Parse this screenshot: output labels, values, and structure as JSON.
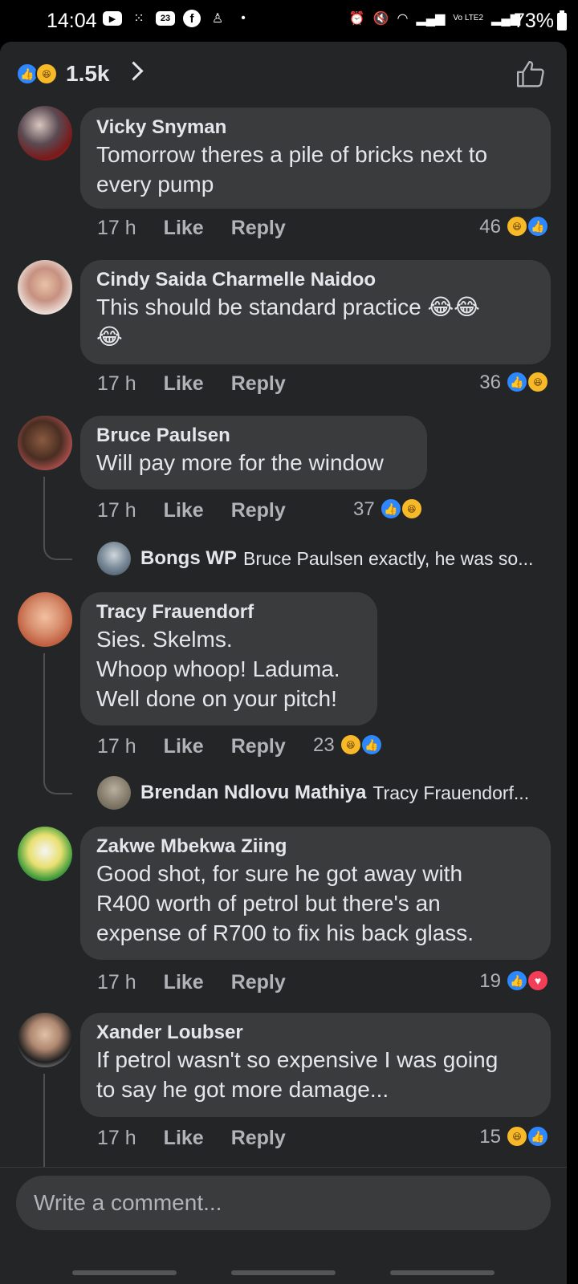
{
  "status_bar": {
    "time": "14:04",
    "calendar_day": "23",
    "network_label": "Vo LTE2",
    "battery": "73%"
  },
  "reactions_header": {
    "count": "1.5k",
    "icons": [
      "like",
      "haha"
    ]
  },
  "comments": [
    {
      "author": "Vicky Snyman",
      "lines": [
        "Tomorrow theres a pile of bricks next to",
        "every pump"
      ],
      "time": "17 h",
      "like": "Like",
      "reply": "Reply",
      "reaction_count": "46",
      "reactions": [
        "haha",
        "like"
      ]
    },
    {
      "author": "Cindy Saida Charmelle Naidoo",
      "lines": [
        "This should be standard practice 😂😂",
        "😂"
      ],
      "time": "17 h",
      "like": "Like",
      "reply": "Reply",
      "reaction_count": "36",
      "reactions": [
        "like",
        "haha"
      ]
    },
    {
      "author": "Bruce Paulsen",
      "lines": [
        "Will pay more for the window"
      ],
      "time": "17 h",
      "like": "Like",
      "reply": "Reply",
      "reaction_count": "37",
      "reactions": [
        "like",
        "haha"
      ],
      "reply_preview": {
        "author": "Bongs WP",
        "text": "Bruce Paulsen exactly, he was so..."
      }
    },
    {
      "author": "Tracy Frauendorf",
      "lines": [
        "Sies. Skelms.",
        "Whoop whoop! Laduma.",
        "Well done on your pitch!"
      ],
      "time": "17 h",
      "like": "Like",
      "reply": "Reply",
      "reaction_count": "23",
      "reactions": [
        "haha",
        "like"
      ],
      "reply_preview": {
        "author": "Brendan Ndlovu Mathiya",
        "text": "Tracy Frauendorf..."
      }
    },
    {
      "author": "Zakwe Mbekwa Ziing",
      "lines": [
        "Good shot, for sure he got away with",
        "R400 worth of petrol but there's an",
        "expense of R700 to fix his back glass."
      ],
      "time": "17 h",
      "like": "Like",
      "reply": "Reply",
      "reaction_count": "19",
      "reactions": [
        "like",
        "love"
      ]
    },
    {
      "author": "Xander Loubser",
      "lines": [
        "If petrol wasn't so expensive I was going",
        "to say he got more damage..."
      ],
      "time": "17 h",
      "like": "Like",
      "reply": "Reply",
      "reaction_count": "15",
      "reactions": [
        "haha",
        "like"
      ]
    }
  ],
  "composer": {
    "placeholder": "Write a comment..."
  },
  "colors": {
    "background": "#242526",
    "bubble": "#3a3b3c",
    "like_blue": "#2d88ff",
    "haha_yellow": "#f7b928",
    "love_red": "#f33e58",
    "text": "#e4e6eb",
    "meta_text": "#b0b3b8"
  }
}
